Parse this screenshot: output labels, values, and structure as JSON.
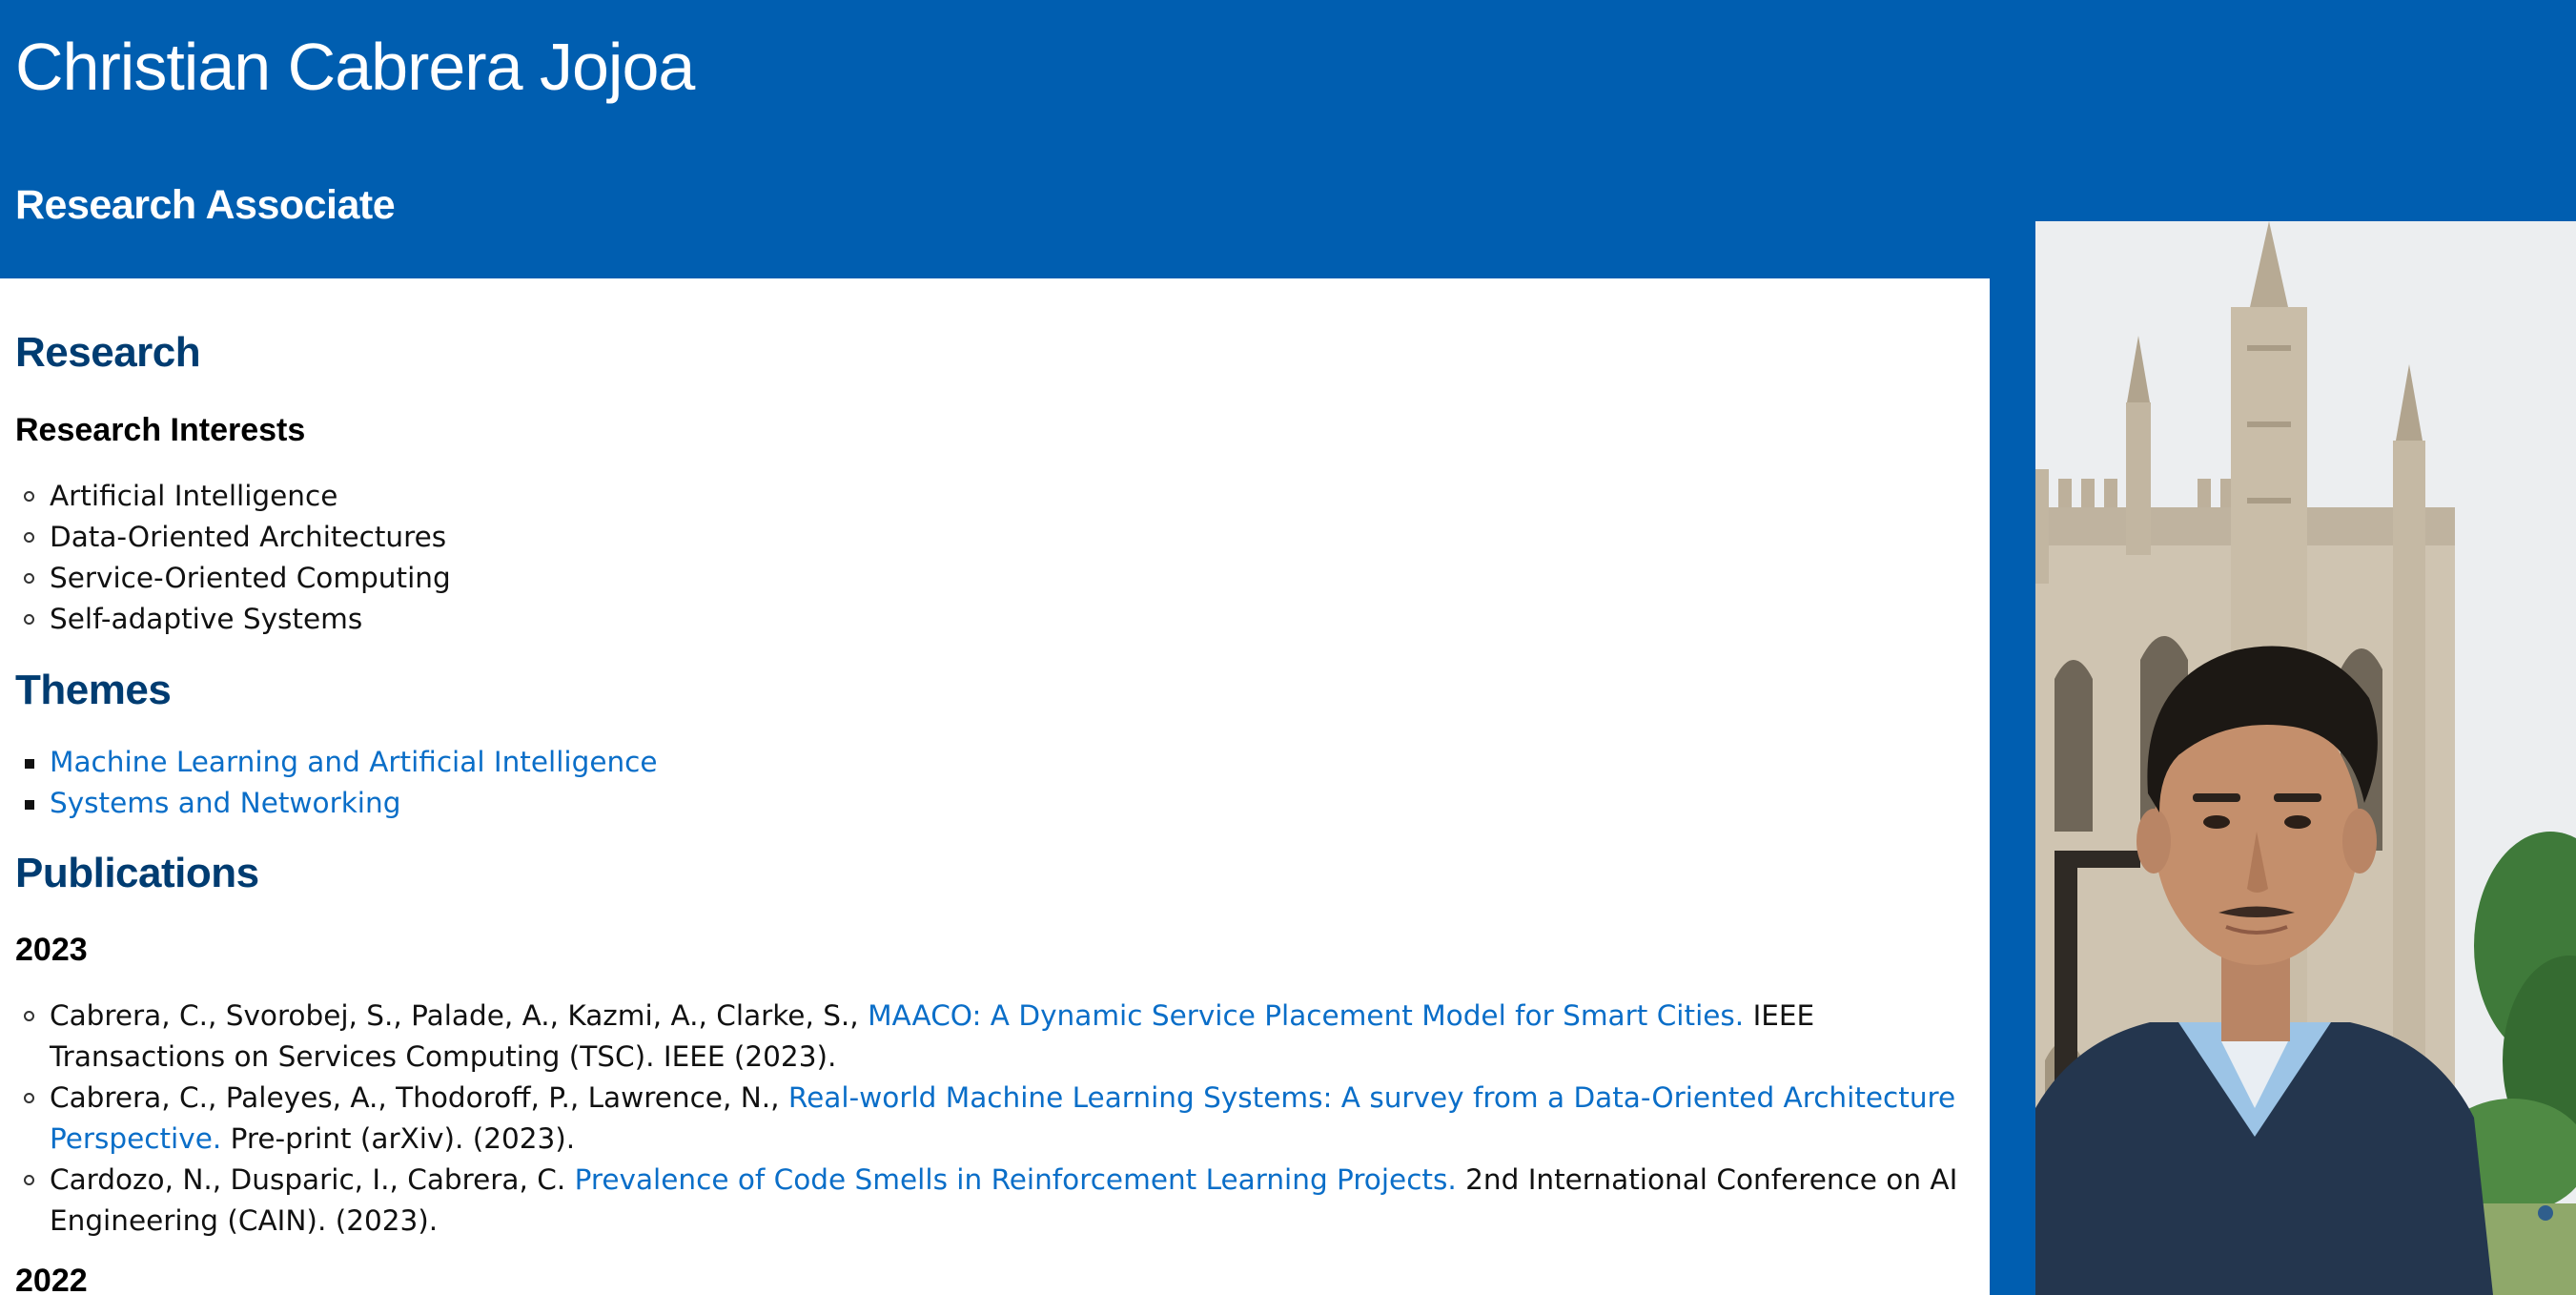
{
  "header": {
    "name": "Christian Cabrera Jojoa",
    "role": "Research Associate"
  },
  "research": {
    "heading": "Research",
    "interests_heading": "Research Interests",
    "interests": [
      "Artificial Intelligence",
      "Data-Oriented Architectures",
      "Service-Oriented Computing",
      "Self-adaptive Systems"
    ]
  },
  "themes": {
    "heading": "Themes",
    "items": [
      "Machine Learning and Artificial Intelligence",
      "Systems and Networking"
    ]
  },
  "publications": {
    "heading": "Publications",
    "years": [
      {
        "year": "2023",
        "items": [
          {
            "authors": "Cabrera, C., Svorobej, S., Palade, A., Kazmi, A., Clarke, S.,",
            "title": "MAACO: A Dynamic Service Placement Model for Smart Cities.",
            "venue_line1": "IEEE",
            "venue_line2": "Transactions on Services Computing (TSC). IEEE (2023)."
          },
          {
            "authors": "Cabrera, C., Paleyes, A., Thodoroff, P., Lawrence, N.,",
            "title_line1": "Real-world Machine Learning Systems: A survey from a Data-Oriented Architecture",
            "title_line2": "Perspective.",
            "venue": "Pre-print (arXiv). (2023)."
          },
          {
            "authors": "Cardozo, N., Dusparic, I., Cabrera, C.",
            "title": "Prevalence of Code Smells in Reinforcement Learning Projects.",
            "venue_line1": "2nd International Conference on AI",
            "venue_line2": "Engineering (CAIN). (2023)."
          }
        ]
      },
      {
        "year": "2022"
      }
    ]
  },
  "colors": {
    "brand_blue": "#005eb0",
    "heading_blue": "#003c71",
    "link_blue": "#0a6ec8"
  },
  "photo": {
    "description_icon": "profile-photo"
  }
}
